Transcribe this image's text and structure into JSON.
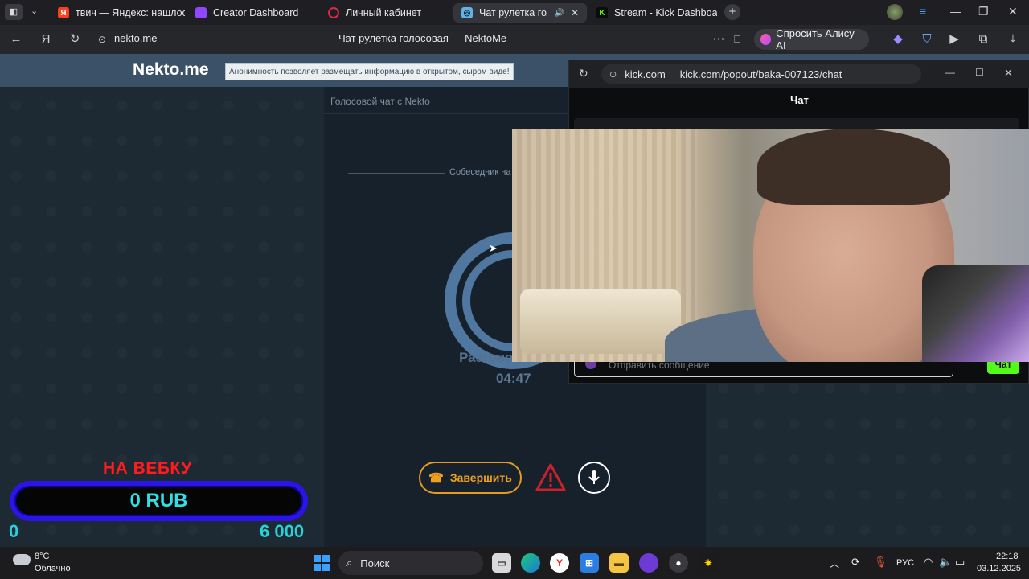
{
  "tabs": [
    {
      "label": "твич — Яндекс: нашлось",
      "icon": "Я",
      "icon_color": "#fc3f1d"
    },
    {
      "label": "Creator Dashboard",
      "icon": "▮",
      "icon_color": "#9146ff"
    },
    {
      "label": "Личный кабинет",
      "icon": "○",
      "icon_color": "#e0284a"
    },
    {
      "label": "Чат рулетка голосов",
      "icon": "◎",
      "icon_color": "#5fb3e8"
    },
    {
      "label": "Stream - Kick Dashboard",
      "icon": "K",
      "icon_color": "#53fc18"
    }
  ],
  "address": {
    "url": "nekto.me",
    "page_title": "Чат рулетка голосовая — NektoMe",
    "alice_label": "Спросить Алису AI"
  },
  "nekto": {
    "logo": "Nekto.me",
    "tagline": "Анонимность позволяет размещать информацию в открытом, сыром виде!",
    "panel_title": "Голосовой чат с Nekto",
    "peer_status": "Собеседник на",
    "talk_label": "Разговор",
    "timer": "04:47",
    "end_button": "Завершить"
  },
  "kick": {
    "domain": "kick.com",
    "url": "kick.com/popout/baka-007123/chat",
    "chat_title": "Чат",
    "input_placeholder": "Отправить сообщение",
    "send_label": "Чат"
  },
  "overlay": {
    "label": "НА ВЕБКУ",
    "current": "0 RUB",
    "min": "0",
    "max": "6 000"
  },
  "taskbar": {
    "temperature": "8°C",
    "weather": "Облачно",
    "search": "Поиск",
    "lang": "РУС",
    "time": "22:18",
    "date": "03.12.2025"
  },
  "colors": {
    "accent_orange": "#f0a021",
    "kick_green": "#53fc18",
    "nekto_blue": "#4f779f"
  }
}
